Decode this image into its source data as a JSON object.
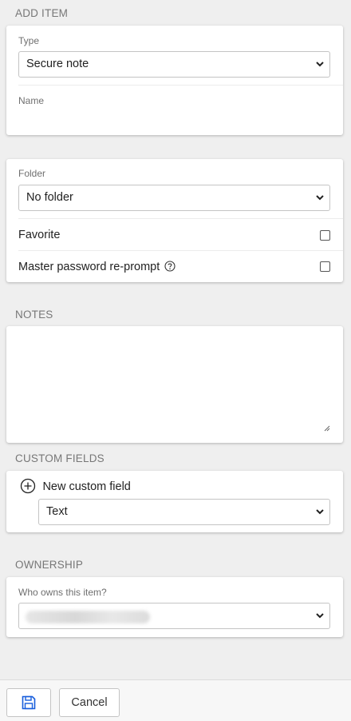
{
  "header": {
    "title": "ADD ITEM"
  },
  "item": {
    "type_label": "Type",
    "type_value": "Secure note",
    "name_label": "Name",
    "name_value": ""
  },
  "organize": {
    "folder_label": "Folder",
    "folder_value": "No folder",
    "favorite_label": "Favorite",
    "favorite_checked": false,
    "reprompt_label": "Master password re-prompt",
    "reprompt_checked": false
  },
  "notes": {
    "title": "NOTES",
    "value": ""
  },
  "custom_fields": {
    "title": "CUSTOM FIELDS",
    "new_field_label": "New custom field",
    "field_type_value": "Text"
  },
  "ownership": {
    "title": "OWNERSHIP",
    "owner_label": "Who owns this item?"
  },
  "footer": {
    "cancel_label": "Cancel"
  }
}
